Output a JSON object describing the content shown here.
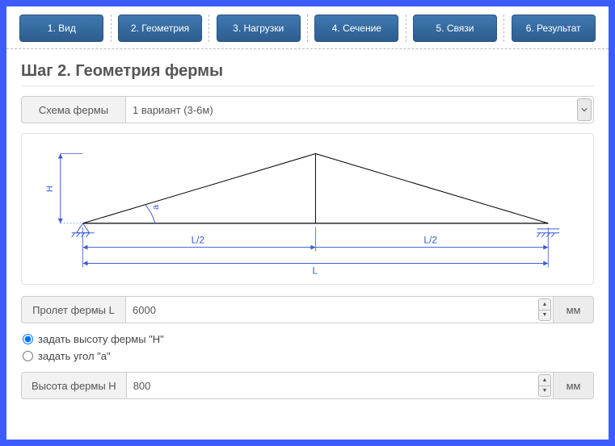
{
  "tabs": [
    "1. Вид",
    "2. Геометрия",
    "3. Нагрузки",
    "4. Сечение",
    "5. Связи",
    "6. Результат"
  ],
  "title": "Шаг 2. Геометрия фермы",
  "scheme": {
    "label": "Схема фермы",
    "value": "1 вариант (3-6м)"
  },
  "span": {
    "label": "Пролет фермы L",
    "value": "6000",
    "unit": "мм"
  },
  "radios": {
    "height": "задать высоту фермы \"H\"",
    "angle": "задать угол \"a\""
  },
  "height_field": {
    "label": "Высота фермы H",
    "value": "800",
    "unit": "мм"
  },
  "diagram": {
    "H": "H",
    "a": "a",
    "L": "L",
    "L2": "L/2"
  }
}
